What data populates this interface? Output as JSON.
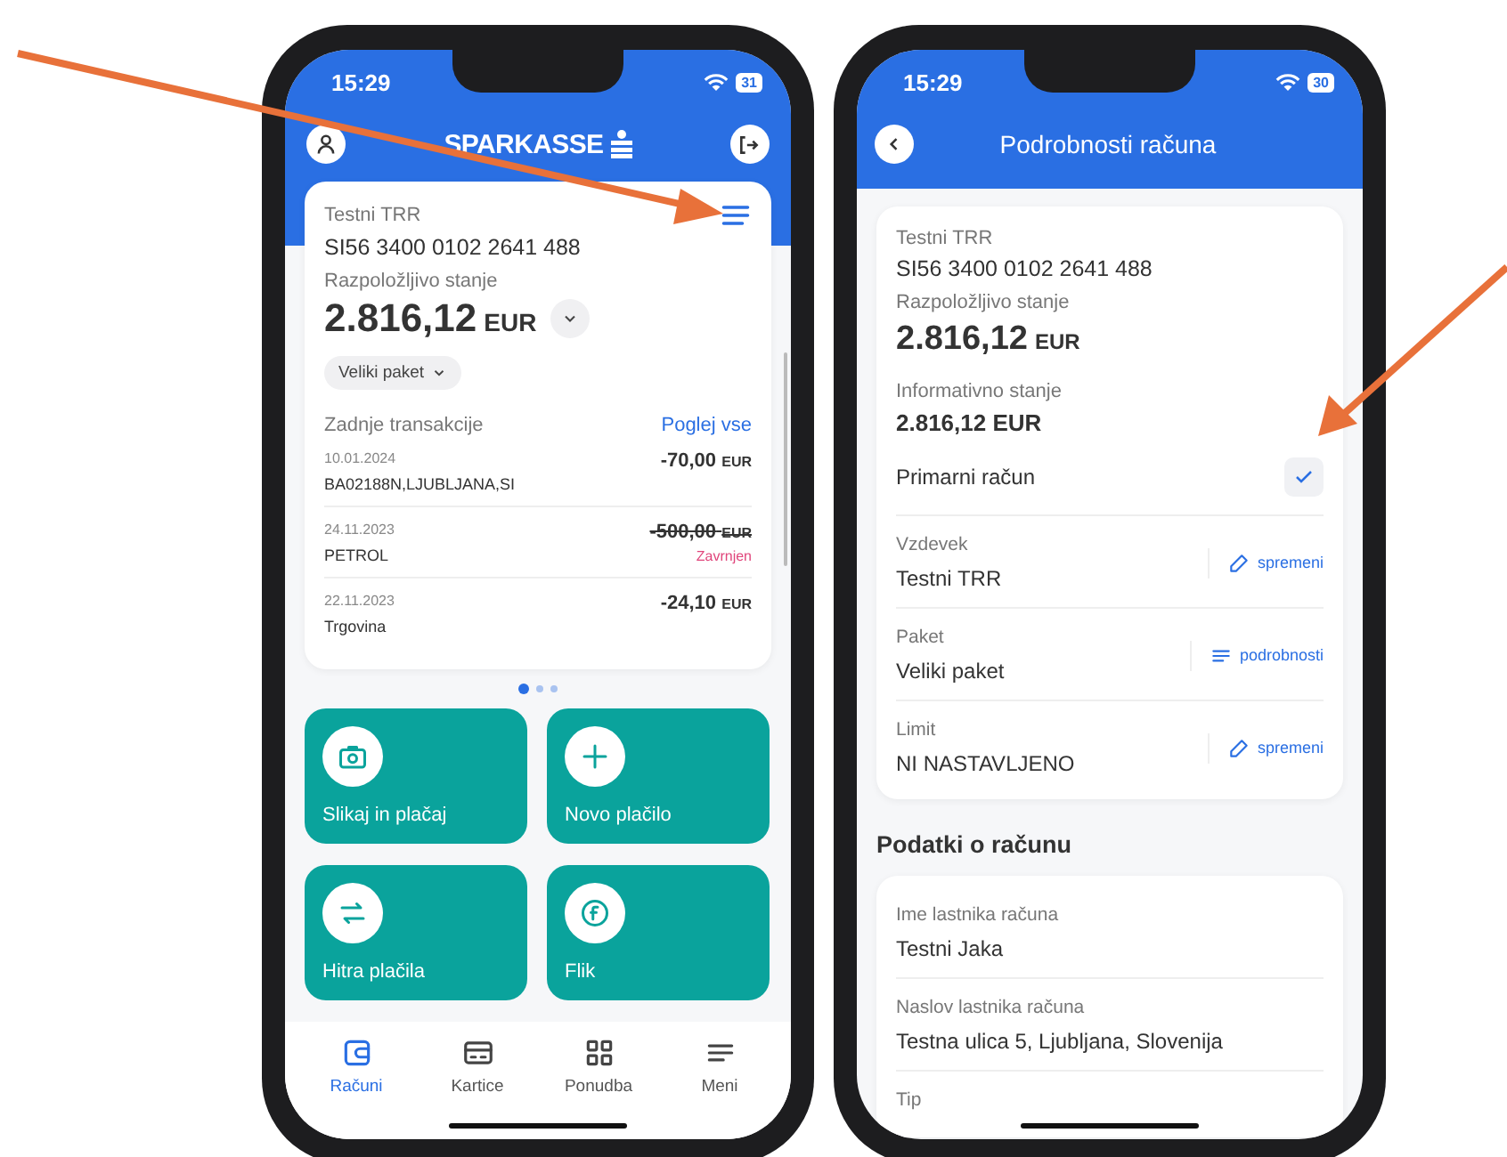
{
  "left_screen": {
    "status_bar": {
      "time": "15:29",
      "battery": "31"
    },
    "header": {
      "logo": "SPARKASSE"
    },
    "account_card": {
      "name": "Testni TRR",
      "iban": "SI56 3400 0102 2641 488",
      "balance_label": "Razpoložljivo stanje",
      "balance_amount": "2.816,12",
      "balance_currency": "EUR",
      "package_chip": "Veliki paket",
      "recent_label": "Zadnje transakcije",
      "view_all": "Poglej vse",
      "transactions": [
        {
          "date": "10.01.2024",
          "description": "BA02188N,LJUBLJANA,SI",
          "amount": "-70,00",
          "currency": "EUR",
          "cancelled": false
        },
        {
          "date": "24.11.2023",
          "description": "PETROL",
          "amount": "-500,00",
          "currency": "EUR",
          "cancelled": true,
          "status": "Zavrnjen"
        },
        {
          "date": "22.11.2023",
          "description": "Trgovina",
          "amount": "-24,10",
          "currency": "EUR",
          "cancelled": false
        }
      ]
    },
    "pager": [
      {
        "selected": true
      },
      {
        "selected": false
      },
      {
        "selected": false
      }
    ],
    "tiles": [
      {
        "kind": "camera",
        "label": "Slikaj in plačaj"
      },
      {
        "kind": "plus",
        "label": "Novo plačilo"
      },
      {
        "kind": "swap",
        "label": "Hitra plačila"
      },
      {
        "kind": "flik",
        "label": "Flik"
      }
    ],
    "tab_bar": [
      {
        "kind": "wallet",
        "label": "Računi",
        "selected": true
      },
      {
        "kind": "card",
        "label": "Kartice",
        "selected": false
      },
      {
        "kind": "grid",
        "label": "Ponudba",
        "selected": false
      },
      {
        "kind": "menu",
        "label": "Meni",
        "selected": false
      }
    ]
  },
  "right_screen": {
    "status_bar": {
      "time": "15:29",
      "battery": "30"
    },
    "header": {
      "title": "Podrobnosti računa"
    },
    "account_card": {
      "name": "Testni TRR",
      "iban": "SI56 3400 0102 2641 488",
      "balance_label": "Razpoložljivo stanje",
      "balance_amount": "2.816,12",
      "balance_currency": "EUR",
      "info_label": "Informativno stanje",
      "info_amount": "2.816,12 EUR",
      "primary_label": "Primarni račun",
      "primary_checked": true,
      "fields": [
        {
          "label": "Vzdevek",
          "value": "Testni TRR",
          "kind": "edit",
          "action": "spremeni"
        },
        {
          "label": "Paket",
          "value": "Veliki paket",
          "kind": "details",
          "action": "podrobnosti"
        },
        {
          "label": "Limit",
          "value": "NI NASTAVLJENO",
          "kind": "edit",
          "action": "spremeni"
        }
      ]
    },
    "section_title": "Podatki o računu",
    "details": [
      {
        "label": "Ime lastnika računa",
        "value": "Testni Jaka"
      },
      {
        "label": "Naslov lastnika računa",
        "value": "Testna ulica 5, Ljubljana, Slovenija"
      },
      {
        "label": "Tip"
      }
    ]
  }
}
